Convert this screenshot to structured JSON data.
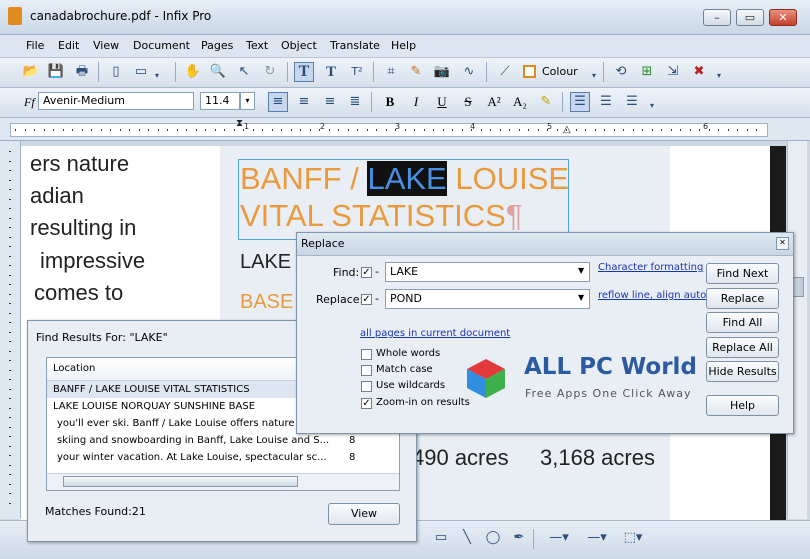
{
  "window": {
    "title": "canadabrochure.pdf - Infix Pro"
  },
  "menu": [
    "File",
    "Edit",
    "View",
    "Document",
    "Pages",
    "Text",
    "Object",
    "Translate",
    "Help"
  ],
  "toolbar1": {
    "colour_label": "Colour"
  },
  "toolbar2": {
    "font_family": "Avenir-Medium",
    "font_size": "11.4"
  },
  "ruler": {
    "numbers": [
      "1",
      "2",
      "3",
      "4",
      "5",
      "6"
    ]
  },
  "document": {
    "left_lines": [
      "ers nature",
      "adian",
      "resulting in",
      "impressive",
      "comes to"
    ],
    "heading_line1_a": "BANFF / ",
    "heading_selected": "LAKE",
    "heading_line1_b": " LOUISE",
    "heading_line2": "VITAL STATISTICS",
    "pilcrow": "¶",
    "text_lake": "LAKE",
    "text_base": "BASE",
    "stat1": "490 acres",
    "stat2": "3,168 acres"
  },
  "replace_dialog": {
    "title": "Replace",
    "find_label": "Find:",
    "find_value": "LAKE",
    "replace_label": "Replace:",
    "replace_value": "POND",
    "char_format_link": "Character formatting",
    "reflow_link": "reflow line, align auto",
    "scope_link": "all pages in current document",
    "options": [
      {
        "label": "Whole words",
        "checked": false
      },
      {
        "label": "Match case",
        "checked": false
      },
      {
        "label": "Use wildcards",
        "checked": false
      },
      {
        "label": "Zoom-in on results",
        "checked": true
      }
    ],
    "buttons": [
      "Find Next",
      "Replace",
      "Find All",
      "Replace All",
      "Hide Results",
      "Help"
    ]
  },
  "find_results": {
    "title": "Find Results For: \"LAKE\"",
    "column_location": "Location",
    "rows": [
      {
        "text": "BANFF / LAKE LOUISE VITAL STATISTICS",
        "page": ""
      },
      {
        "text": "LAKE LOUISE NORQUAY SUNSHINE BASE",
        "page": ""
      },
      {
        "text": "you'll ever ski. Banff / Lake Louise offers nature a...",
        "page": ""
      },
      {
        "text": "skiing and snowboarding in Banff, Lake Louise and S...",
        "page": "8"
      },
      {
        "text": "your winter vacation. At Lake Louise, spectacular sc...",
        "page": "8"
      }
    ],
    "matches_label": "Matches Found:21",
    "view_button": "View"
  },
  "watermark": {
    "title": "ALL PC World",
    "subtitle": "Free Apps One Click Away"
  },
  "colors": {
    "accent_orange": "#e89a3c",
    "selection": "#111111",
    "link_blue": "#1a35b0"
  }
}
